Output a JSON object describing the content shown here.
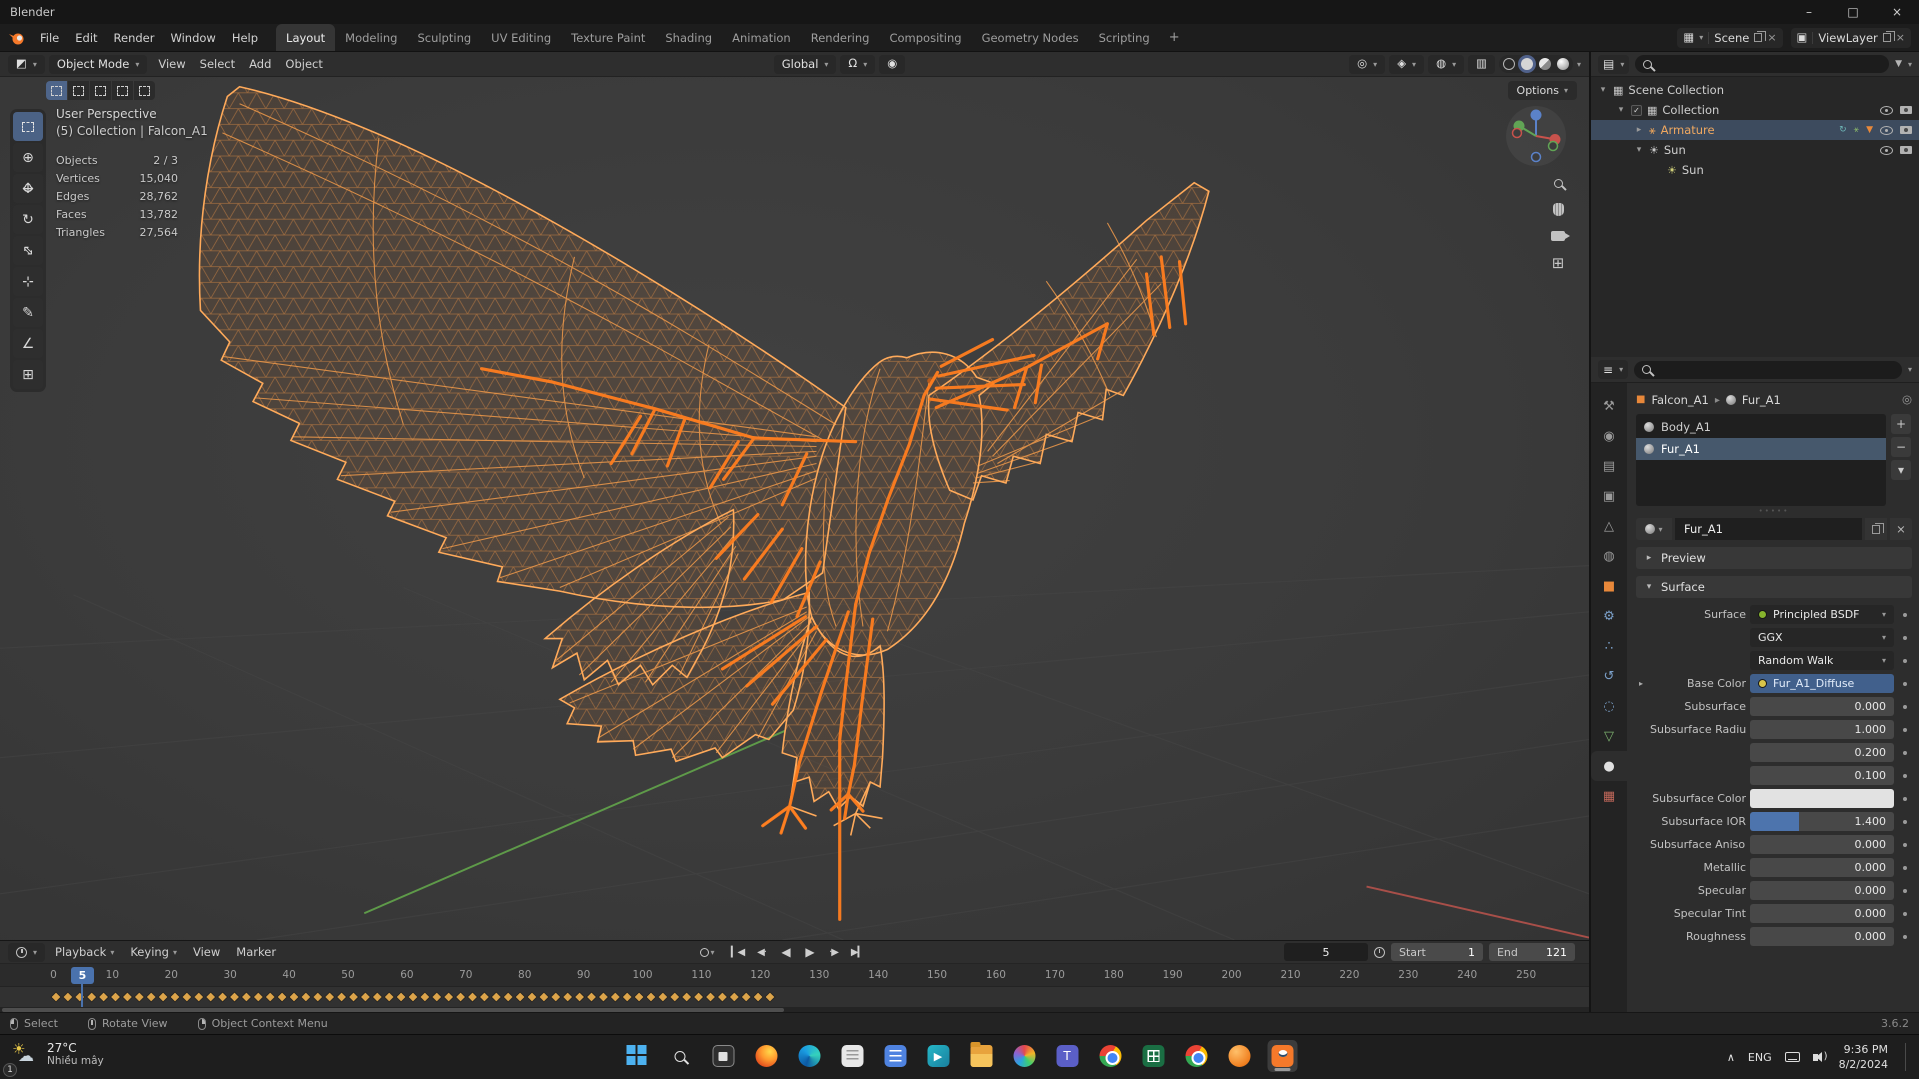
{
  "window": {
    "title": "Blender"
  },
  "icons": {
    "minimize": "–",
    "maximize": "□",
    "close": "×",
    "caret_down": "▾",
    "expand_right": "▸",
    "expand_down": "▾",
    "editor_viewport": "◩",
    "editor_outliner": "▤",
    "editor_properties": "≡",
    "editor_timeline": "◷",
    "scene_db": "▦",
    "view_layer_db": "▣",
    "pin": "◎",
    "funnel": "▼",
    "pivot": "◎",
    "magnet": "Ω",
    "proportional": "◉",
    "gizmo_toggle": "◈",
    "overlay_toggle": "◍",
    "xray_toggle": "▥",
    "persp_grid": "⊞",
    "tool_cursor": "⊕",
    "tool_rotate": "↻",
    "tool_scale": "⇔",
    "tool_transform": "⊹",
    "tool_annotate": "✎",
    "tool_measure": "∠",
    "tool_add_cube": "⊞",
    "jump_start": "▎◀",
    "key_prev": "◀·",
    "play_reverse": "◀",
    "play": "▶",
    "key_next": "·▶",
    "jump_end": "▶▎",
    "tab_tool": "⚒",
    "tab_render": "◉",
    "tab_output": "▤",
    "tab_view_layer": "▣",
    "tab_scene": "△",
    "tab_world": "◍",
    "tab_object": "■",
    "tab_modifiers": "⚙",
    "tab_particles": "∴",
    "tab_physics": "↺",
    "tab_constraints": "◌",
    "tab_data": "▽",
    "tab_material": "●",
    "tab_texture": "▦",
    "collection": "▦",
    "armature": "⚹",
    "sun": "☀",
    "check": "✓",
    "plus": "+",
    "minus": "−",
    "tray_chevron": "∧"
  },
  "colors": {
    "accent_blue": "#4a72ad",
    "wireframe_orange": "#ffaa5a",
    "bone_orange": "#ff7d1f",
    "keyframe_yellow": "#dca44a",
    "axis_y_green": "#5e9a49",
    "axis_x_red": "#a84f49"
  },
  "topbar": {
    "menus": [
      "File",
      "Edit",
      "Render",
      "Window",
      "Help"
    ],
    "workspaces": [
      {
        "label": "Layout",
        "cls": "active"
      },
      {
        "label": "Modeling"
      },
      {
        "label": "Sculpting"
      },
      {
        "label": "UV Editing"
      },
      {
        "label": "Texture Paint"
      },
      {
        "label": "Shading"
      },
      {
        "label": "Animation"
      },
      {
        "label": "Rendering"
      },
      {
        "label": "Compositing"
      },
      {
        "label": "Geometry Nodes"
      },
      {
        "label": "Scripting"
      }
    ],
    "add_workspace": "+",
    "scene_name": "Scene",
    "view_layer_name": "ViewLayer"
  },
  "viewport_header": {
    "mode": "Object Mode",
    "menus": [
      "View",
      "Select",
      "Add",
      "Object"
    ],
    "orientation": "Global",
    "options": "Options"
  },
  "viewport": {
    "projection": "User Perspective",
    "context": "(5) Collection | Falcon_A1",
    "stats": [
      {
        "label": "Objects",
        "value": "2 / 3"
      },
      {
        "label": "Vertices",
        "value": "15,040"
      },
      {
        "label": "Edges",
        "value": "28,762"
      },
      {
        "label": "Faces",
        "value": "13,782"
      },
      {
        "label": "Triangles",
        "value": "27,564"
      }
    ]
  },
  "outliner": {
    "items": [
      {
        "label": "Scene Collection"
      },
      {
        "label": "Collection"
      },
      {
        "label": "Armature"
      },
      {
        "label": "Sun"
      },
      {
        "label": "Sun"
      }
    ]
  },
  "properties": {
    "breadcrumb": {
      "object": "Falcon_A1",
      "data": "Fur_A1"
    },
    "slots": [
      {
        "label": "Body_A1"
      },
      {
        "label": "Fur_A1",
        "cls": "selected"
      }
    ],
    "material_name": "Fur_A1",
    "sections": {
      "preview": "Preview",
      "surface": "Surface"
    },
    "surface_rows": [
      {
        "label": "Surface",
        "value": "Principled BSDF",
        "cls": "t-drop s-green"
      },
      {
        "label": "",
        "value": "GGX",
        "cls": "t-drop"
      },
      {
        "label": "",
        "value": "Random Walk",
        "cls": "t-drop"
      },
      {
        "label": "Base Color",
        "value": "Fur_A1_Diffuse",
        "cls": "t-link s-yellow",
        "exp": "▸"
      },
      {
        "label": "Subsurface",
        "value": "0.000",
        "cls": "t-num"
      },
      {
        "label": "Subsurface Radius",
        "value": "1.000",
        "cls": "t-num"
      },
      {
        "label": "",
        "value": "0.200",
        "cls": "t-num"
      },
      {
        "label": "",
        "value": "0.100",
        "cls": "t-num"
      },
      {
        "label": "Subsurface Color",
        "value": "",
        "cls": "t-color"
      },
      {
        "label": "Subsurface IOR",
        "value": "1.400",
        "cls": "t-ior"
      },
      {
        "label": "Subsurface Aniso...",
        "value": "0.000",
        "cls": "t-num"
      },
      {
        "label": "Metallic",
        "value": "0.000",
        "cls": "t-num"
      },
      {
        "label": "Specular",
        "value": "0.000",
        "cls": "t-num"
      },
      {
        "label": "Specular Tint",
        "value": "0.000",
        "cls": "t-num"
      },
      {
        "label": "Roughness",
        "value": "0.000",
        "cls": "t-num"
      }
    ]
  },
  "timeline": {
    "menus": [
      {
        "label": "Playback",
        "cls": "has-caret"
      },
      {
        "label": "Keying",
        "cls": "has-caret"
      },
      {
        "label": "View"
      },
      {
        "label": "Marker"
      }
    ],
    "frame": "5",
    "start_label": "Start",
    "start": "1",
    "end_label": "End",
    "end": "121",
    "ticks": [
      "0",
      "10",
      "20",
      "30",
      "40",
      "50",
      "60",
      "70",
      "80",
      "90",
      "100",
      "110",
      "120",
      "130",
      "140",
      "150",
      "160",
      "170",
      "180",
      "190",
      "200",
      "210",
      "220",
      "230",
      "240",
      "250"
    ]
  },
  "statusbar": {
    "items": [
      "Select",
      "Rotate View",
      "Object Context Menu"
    ],
    "version": "3.6.2"
  },
  "taskbar": {
    "weather_temp": "27°C",
    "weather_desc": "Nhiều mây",
    "badge": "1",
    "lang": "ENG",
    "time": "9:36 PM",
    "date": "8/2/2024"
  }
}
